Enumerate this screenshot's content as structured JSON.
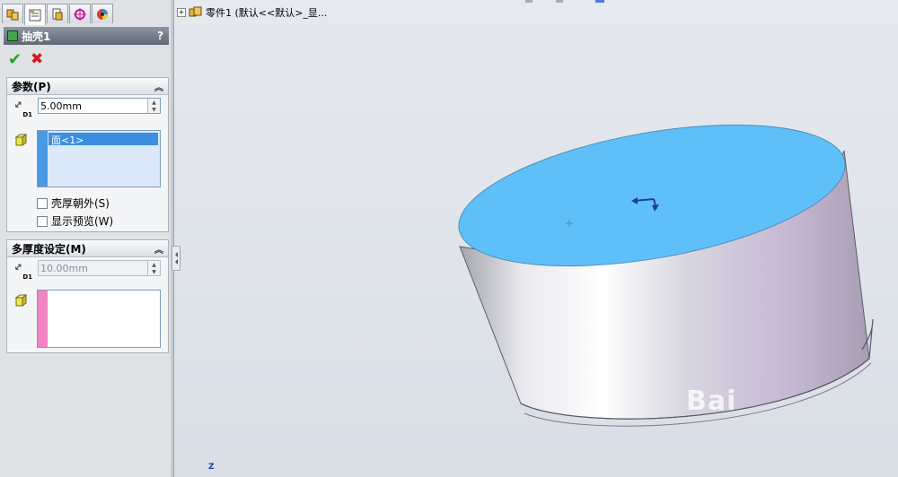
{
  "panel": {
    "tabs": [
      "feature-manager-icon",
      "property-manager-icon",
      "configuration-manager-icon",
      "dimxpert-icon",
      "display-manager-icon"
    ],
    "title": "抽壳1",
    "help": "?",
    "ok": "✔",
    "cancel": "✖"
  },
  "params": {
    "header": "参数(P)",
    "thickness": "5.00mm",
    "faces": [
      "面<1>"
    ],
    "shell_outward": "壳厚朝外(S)",
    "show_preview": "显示预览(W)"
  },
  "multi": {
    "header": "多厚度设定(M)",
    "thickness": "10.00mm"
  },
  "tree": {
    "part_label": "零件1  (默认<<默认>_显..."
  },
  "triad": {
    "label": "Z"
  },
  "watermark": {
    "text": "Bai"
  },
  "colors": {
    "face_highlight": "#5fc0f9",
    "cylinder_side": "#c9c6d6",
    "list_strip_blue": "#4a98e6",
    "list_strip_pink": "#f185c3"
  }
}
